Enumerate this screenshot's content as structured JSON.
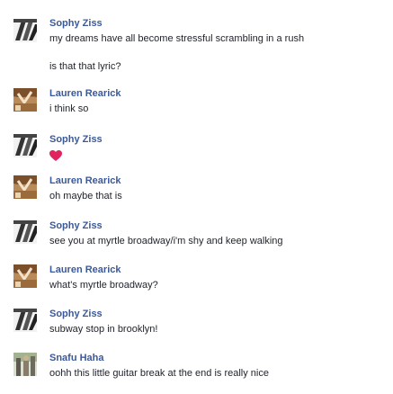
{
  "conversation": {
    "messages": [
      {
        "author": "Sophy Ziss",
        "avatar": "sophy-avatar",
        "lines": [
          "my dreams have all become stressful scrambling in a rush",
          "is that that lyric?"
        ]
      },
      {
        "author": "Lauren Rearick",
        "avatar": "lauren-avatar",
        "lines": [
          "i think so"
        ]
      },
      {
        "author": "Sophy Ziss",
        "avatar": "sophy-avatar",
        "lines": [],
        "emoji": "heart-icon"
      },
      {
        "author": "Lauren Rearick",
        "avatar": "lauren-avatar",
        "lines": [
          "oh maybe that is"
        ]
      },
      {
        "author": "Sophy Ziss",
        "avatar": "sophy-avatar",
        "lines": [
          "see you at myrtle broadway/i'm shy and keep walking"
        ]
      },
      {
        "author": "Lauren Rearick",
        "avatar": "lauren-avatar",
        "lines": [
          "what's myrtle broadway?"
        ]
      },
      {
        "author": "Sophy Ziss",
        "avatar": "sophy-avatar",
        "lines": [
          "subway stop in brooklyn!"
        ]
      },
      {
        "author": "Snafu Haha",
        "avatar": "snafu-avatar",
        "lines": [
          "oohh this little guitar break at the end is really nice"
        ]
      }
    ]
  },
  "colors": {
    "author_name": "#3b5998",
    "message_text": "#1d2129",
    "heart": "#e0245e"
  }
}
